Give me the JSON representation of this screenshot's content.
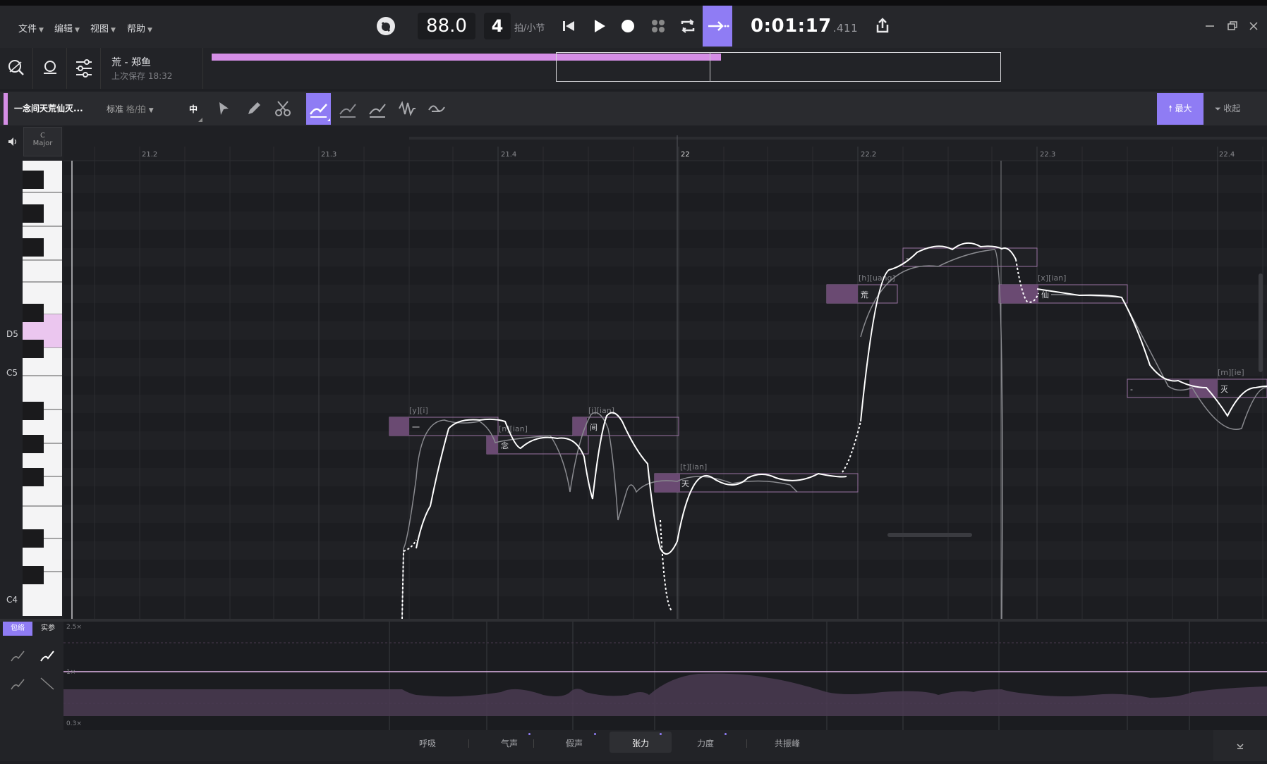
{
  "menu": {
    "file": "文件",
    "edit": "编辑",
    "view": "视图",
    "help": "帮助"
  },
  "transport": {
    "tempo": "88.0",
    "beats": "4",
    "beats_unit": "拍/小节",
    "time_main": "0:01:17",
    "time_ms": ".411"
  },
  "project": {
    "title": "荒 - 郑鱼",
    "last_saved": "上次保存 18:32"
  },
  "track": {
    "name": "一念间天荒仙灭...",
    "mode": "标准",
    "mode_sub": "格/拍",
    "size": "中",
    "max_label": "最大",
    "collapse_label": "收起"
  },
  "key_signature": {
    "root": "C",
    "scale": "Major"
  },
  "piano_labels": {
    "d5": "D5",
    "c5": "C5",
    "c4": "C4"
  },
  "ruler": [
    "21.2",
    "21.3",
    "21.4",
    "22",
    "22.2",
    "22.3",
    "22.4"
  ],
  "notes": [
    {
      "phoneme": "[y][i]",
      "lyric": "一"
    },
    {
      "phoneme": "[n][ian]",
      "lyric": "念"
    },
    {
      "phoneme": "[j][ian]",
      "lyric": "间"
    },
    {
      "phoneme": "[t][ian]",
      "lyric": "天"
    },
    {
      "phoneme": "[h][uang]",
      "lyric": "荒"
    },
    {
      "phoneme": "",
      "lyric": "-"
    },
    {
      "phoneme": "[x][ian]",
      "lyric": "仙"
    },
    {
      "phoneme": "",
      "lyric": "-"
    },
    {
      "phoneme": "[m][ie]",
      "lyric": "灭"
    }
  ],
  "param_panel": {
    "tab_envelope": "包络",
    "tab_real": "实参",
    "scale_top": "2.5×",
    "scale_mid": "1×",
    "scale_bottom": "0.3×"
  },
  "bottom_tabs": [
    "呼吸",
    "气声",
    "假声",
    "张力",
    "力度",
    "共振峰"
  ],
  "active_tab": "张力",
  "colors": {
    "accent": "#8f7cf4",
    "note_fill": "#5a4060",
    "note_border": "#a07aa8",
    "progress": "#d58ee6"
  }
}
